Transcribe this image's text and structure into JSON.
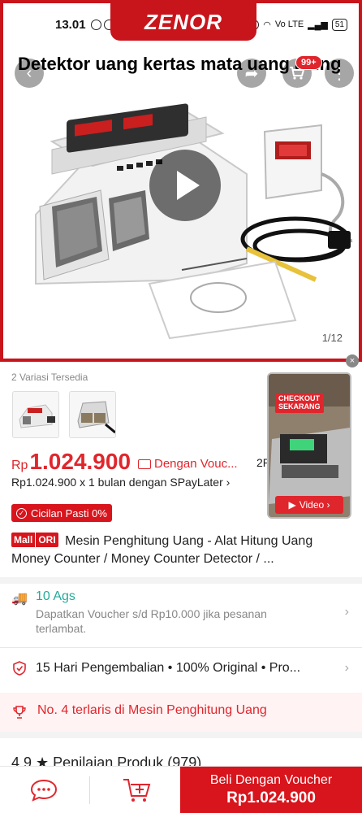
{
  "status_bar": {
    "time": "13.01",
    "battery": "51",
    "network": "Vo LTE"
  },
  "brand": {
    "watermark": "ZENOR"
  },
  "hero": {
    "title": "Detektor uang kertas mata uang asing",
    "cart_badge": "99+",
    "image_counter": "1/12",
    "close_symbol": "×"
  },
  "variants": {
    "label": "2 Variasi Tersedia"
  },
  "price": {
    "currency": "Rp",
    "amount": "1.024.900",
    "voucher_label": "Dengan Vouc...",
    "partial_label": "2R",
    "installment": "Rp1.024.900 x 1 bulan dengan SPayLater ›",
    "cicilan_label": "Cicilan Pasti 0%"
  },
  "floating_video": {
    "badge_line1": "CHECKOUT",
    "badge_line2": "SEKARANG",
    "button_label": "Video ›"
  },
  "product": {
    "mall_badge": "Mall",
    "ori_badge": "ORI",
    "title": "Mesin Penghitung Uang - Alat Hitung Uang Money Counter / Money Counter Detector / ..."
  },
  "shipping": {
    "date": "10 Ags",
    "description": "Dapatkan Voucher s/d Rp10.000 jika pesanan terlambat."
  },
  "guarantee": {
    "text": "15 Hari Pengembalian • 100% Original • Pro..."
  },
  "bestseller": {
    "text": "No. 4 terlaris di Mesin Penghitung Uang"
  },
  "rating_peek": {
    "text": "4.9 ★ Penilaian Produk (979)"
  },
  "bottom_bar": {
    "buy_label": "Beli Dengan Voucher",
    "buy_price": "Rp1.024.900"
  },
  "colors": {
    "brand_red": "#d8141c",
    "price_red": "#e0262d",
    "teal": "#26aa99"
  },
  "icons": {
    "back": "chevron-left-icon",
    "share": "share-icon",
    "cart": "cart-icon",
    "more": "more-icon",
    "chat": "chat-icon",
    "add_to_cart": "add-to-cart-icon",
    "truck": "truck-icon",
    "shield": "shield-icon",
    "trophy": "trophy-icon"
  }
}
